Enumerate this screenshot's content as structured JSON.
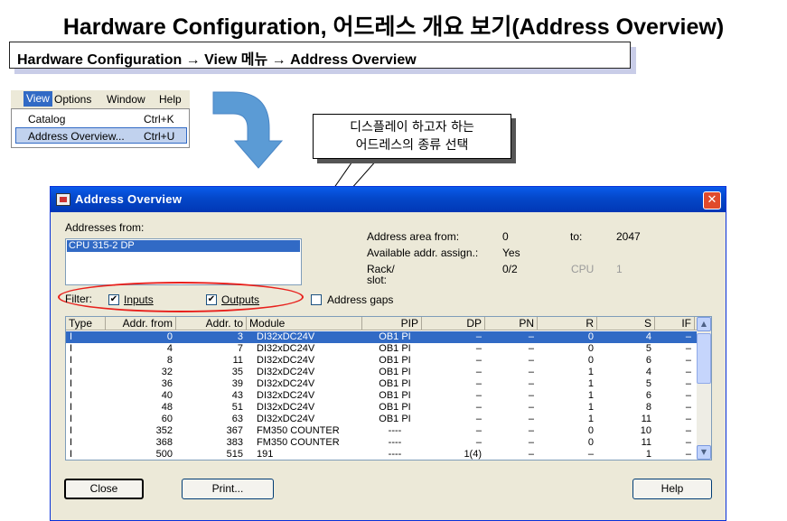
{
  "slide": {
    "title": "Hardware Configuration, 어드레스 개요 보기(Address Overview)",
    "path": "Hardware Configuration → View 메뉴 → Address Overview",
    "callout_line1": "디스플레이 하고자 하는",
    "callout_line2": "어드레스의 종류 선택"
  },
  "menu": {
    "items": [
      "View",
      "Options",
      "Window",
      "Help"
    ],
    "dropdown": [
      {
        "label": "Catalog",
        "shortcut": "Ctrl+K"
      },
      {
        "label": "Address Overview...",
        "shortcut": "Ctrl+U"
      }
    ]
  },
  "window": {
    "title": "Address Overview",
    "close_glyph": "✕",
    "addresses_from_label": "Addresses from:",
    "addresses_from_value": "CPU 315-2 DP",
    "area_from_label": "Address area from:",
    "area_from_value": "0",
    "to_label": "to:",
    "to_value": "2047",
    "avail_label": "Available addr. assign.:",
    "avail_value": "Yes",
    "rack_label": "Rack/",
    "slot_label": "slot:",
    "rack_value": "0/2",
    "cpu_label": "CPU",
    "cpu_value": "1",
    "filter_label": "Filter:",
    "inputs_label": "Inputs",
    "outputs_label": "Outputs",
    "gaps_label": "Address gaps",
    "inputs_checked": true,
    "outputs_checked": true,
    "gaps_checked": false,
    "columns": [
      "Type",
      "Addr. from",
      "Addr. to",
      "Module",
      "PIP",
      "DP",
      "PN",
      "R",
      "S",
      "IF"
    ],
    "rows": [
      [
        "I",
        "0",
        "3",
        "DI32xDC24V",
        "OB1 PI",
        "–",
        "–",
        "0",
        "4",
        "–"
      ],
      [
        "I",
        "4",
        "7",
        "DI32xDC24V",
        "OB1 PI",
        "–",
        "–",
        "0",
        "5",
        "–"
      ],
      [
        "I",
        "8",
        "11",
        "DI32xDC24V",
        "OB1 PI",
        "–",
        "–",
        "0",
        "6",
        "–"
      ],
      [
        "I",
        "32",
        "35",
        "DI32xDC24V",
        "OB1 PI",
        "–",
        "–",
        "1",
        "4",
        "–"
      ],
      [
        "I",
        "36",
        "39",
        "DI32xDC24V",
        "OB1 PI",
        "–",
        "–",
        "1",
        "5",
        "–"
      ],
      [
        "I",
        "40",
        "43",
        "DI32xDC24V",
        "OB1 PI",
        "–",
        "–",
        "1",
        "6",
        "–"
      ],
      [
        "I",
        "48",
        "51",
        "DI32xDC24V",
        "OB1 PI",
        "–",
        "–",
        "1",
        "8",
        "–"
      ],
      [
        "I",
        "60",
        "63",
        "DI32xDC24V",
        "OB1 PI",
        "–",
        "–",
        "1",
        "11",
        "–"
      ],
      [
        "I",
        "352",
        "367",
        "FM350 COUNTER",
        "----",
        "–",
        "–",
        "0",
        "10",
        "–"
      ],
      [
        "I",
        "368",
        "383",
        "FM350 COUNTER",
        "----",
        "–",
        "–",
        "0",
        "11",
        "–"
      ],
      [
        "I",
        "500",
        "515",
        "191",
        "----",
        "1(4)",
        "–",
        "–",
        "1",
        "–"
      ]
    ],
    "buttons": {
      "close": "Close",
      "print": "Print...",
      "help": "Help"
    }
  }
}
